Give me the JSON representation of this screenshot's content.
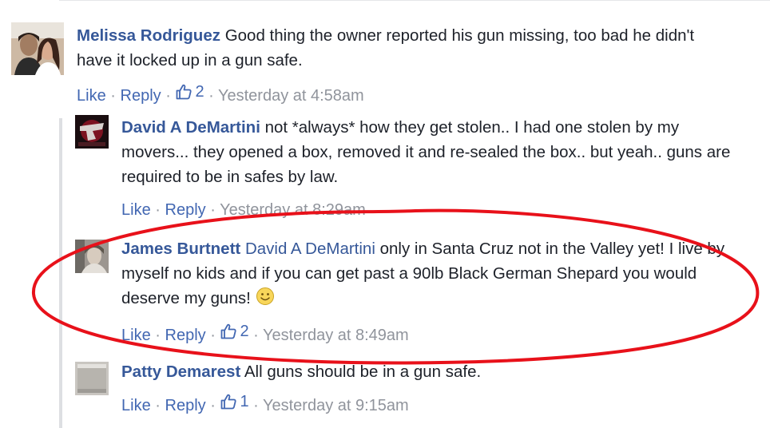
{
  "comments": [
    {
      "author": "Melissa Rodriguez",
      "text": "Good thing the owner reported his gun missing, too bad he didn't have it locked up in a gun safe.",
      "like_label": "Like",
      "reply_label": "Reply",
      "like_count": "2",
      "timestamp": "Yesterday at 4:58am"
    },
    {
      "author": "David A DeMartini",
      "text": "not *always* how they get stolen.. I had one stolen by my movers... they opened a box, removed it and re-sealed the box.. but yeah.. guns are required to be in safes by law.",
      "like_label": "Like",
      "reply_label": "Reply",
      "timestamp": "Yesterday at 8:29am"
    },
    {
      "author": "James Burtnett",
      "mention": "David A DeMartini",
      "text": "only in Santa Cruz not in the Valley yet! I live by myself no kids and if you can get past a 90lb Black German Shepard you would deserve my guns!",
      "emoji": "smiley-face-icon",
      "like_label": "Like",
      "reply_label": "Reply",
      "like_count": "2",
      "timestamp": "Yesterday at 8:49am"
    },
    {
      "author": "Patty Demarest",
      "text": "All guns should be in a gun safe.",
      "like_label": "Like",
      "reply_label": "Reply",
      "like_count": "1",
      "timestamp": "Yesterday at 9:15am"
    }
  ],
  "colors": {
    "author_link": "#365899",
    "action_link": "#4267b2",
    "meta_gray": "#90949c",
    "highlight_ellipse": "#e8111a"
  }
}
